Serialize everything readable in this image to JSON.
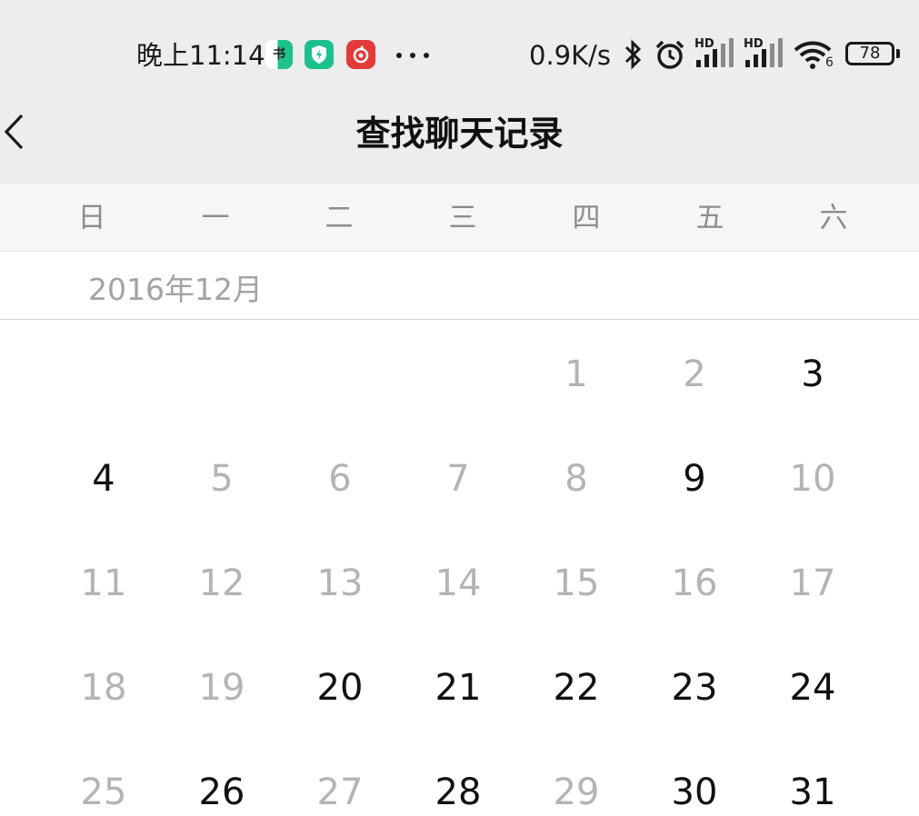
{
  "status_bar": {
    "time": "晚上11:14",
    "app_icons": [
      "novel-app-icon",
      "shield-app-icon",
      "netease-music-icon"
    ],
    "network_speed": "0.9K/s",
    "signal_label": "HD",
    "wifi_slot": "6",
    "battery": "78"
  },
  "header": {
    "title": "查找聊天记录",
    "back_icon": "chevron-left-icon"
  },
  "calendar": {
    "weekdays": [
      "日",
      "一",
      "二",
      "三",
      "四",
      "五",
      "六"
    ],
    "month": "2016年12月",
    "days": [
      {
        "day": "1",
        "has_messages": false,
        "col": 4,
        "row": 0
      },
      {
        "day": "2",
        "has_messages": false,
        "col": 5,
        "row": 0
      },
      {
        "day": "3",
        "has_messages": true,
        "col": 6,
        "row": 0
      },
      {
        "day": "4",
        "has_messages": true,
        "col": 0,
        "row": 1
      },
      {
        "day": "5",
        "has_messages": false,
        "col": 1,
        "row": 1
      },
      {
        "day": "6",
        "has_messages": false,
        "col": 2,
        "row": 1
      },
      {
        "day": "7",
        "has_messages": false,
        "col": 3,
        "row": 1
      },
      {
        "day": "8",
        "has_messages": false,
        "col": 4,
        "row": 1
      },
      {
        "day": "9",
        "has_messages": true,
        "col": 5,
        "row": 1
      },
      {
        "day": "10",
        "has_messages": false,
        "col": 6,
        "row": 1
      },
      {
        "day": "11",
        "has_messages": false,
        "col": 0,
        "row": 2
      },
      {
        "day": "12",
        "has_messages": false,
        "col": 1,
        "row": 2
      },
      {
        "day": "13",
        "has_messages": false,
        "col": 2,
        "row": 2
      },
      {
        "day": "14",
        "has_messages": false,
        "col": 3,
        "row": 2
      },
      {
        "day": "15",
        "has_messages": false,
        "col": 4,
        "row": 2
      },
      {
        "day": "16",
        "has_messages": false,
        "col": 5,
        "row": 2
      },
      {
        "day": "17",
        "has_messages": false,
        "col": 6,
        "row": 2
      },
      {
        "day": "18",
        "has_messages": false,
        "col": 0,
        "row": 3
      },
      {
        "day": "19",
        "has_messages": false,
        "col": 1,
        "row": 3
      },
      {
        "day": "20",
        "has_messages": true,
        "col": 2,
        "row": 3
      },
      {
        "day": "21",
        "has_messages": true,
        "col": 3,
        "row": 3
      },
      {
        "day": "22",
        "has_messages": true,
        "col": 4,
        "row": 3
      },
      {
        "day": "23",
        "has_messages": true,
        "col": 5,
        "row": 3
      },
      {
        "day": "24",
        "has_messages": true,
        "col": 6,
        "row": 3
      },
      {
        "day": "25",
        "has_messages": false,
        "col": 0,
        "row": 4
      },
      {
        "day": "26",
        "has_messages": true,
        "col": 1,
        "row": 4
      },
      {
        "day": "27",
        "has_messages": false,
        "col": 2,
        "row": 4
      },
      {
        "day": "28",
        "has_messages": true,
        "col": 3,
        "row": 4
      },
      {
        "day": "29",
        "has_messages": false,
        "col": 4,
        "row": 4
      },
      {
        "day": "30",
        "has_messages": true,
        "col": 5,
        "row": 4
      },
      {
        "day": "31",
        "has_messages": true,
        "col": 6,
        "row": 4
      }
    ]
  },
  "colors": {
    "header_bg": "#ededed",
    "weekday_bg": "#f6f6f6",
    "day_active": "#111111",
    "day_inactive": "#b4b4b4"
  }
}
